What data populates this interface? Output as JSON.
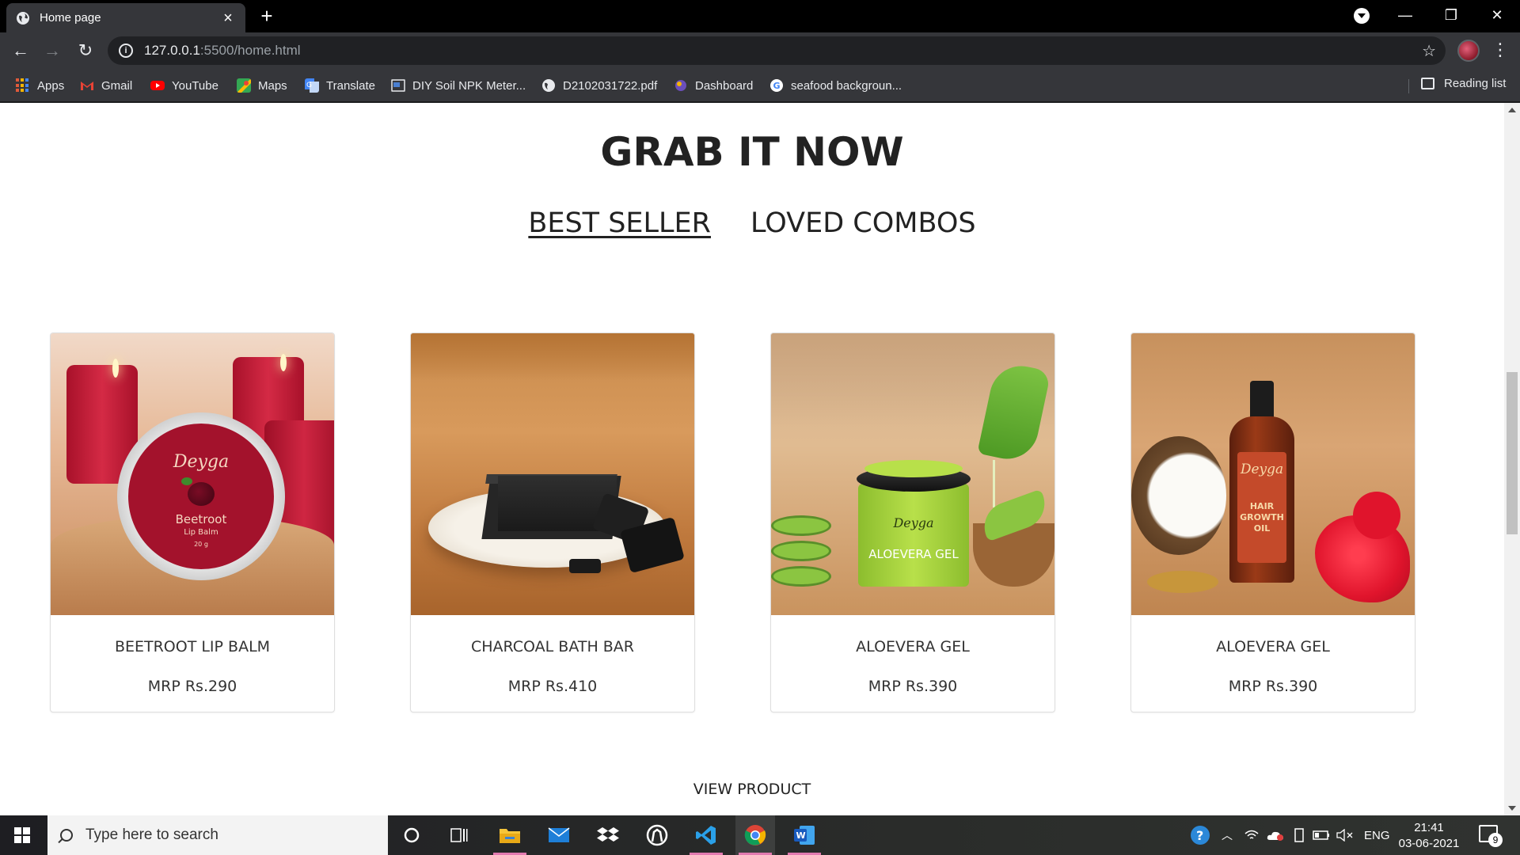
{
  "browser": {
    "tab_title": "Home page",
    "url_host": "127.0.0.1",
    "url_path": ":5500/home.html",
    "bookmarks": [
      {
        "label": "Apps",
        "icon": "apps-grid-icon"
      },
      {
        "label": "Gmail",
        "icon": "gmail-icon"
      },
      {
        "label": "YouTube",
        "icon": "youtube-icon"
      },
      {
        "label": "Maps",
        "icon": "maps-icon"
      },
      {
        "label": "Translate",
        "icon": "translate-icon"
      },
      {
        "label": "DIY Soil NPK Meter...",
        "icon": "page-icon"
      },
      {
        "label": "D2102031722.pdf",
        "icon": "globe-icon"
      },
      {
        "label": "Dashboard",
        "icon": "dashboard-icon"
      },
      {
        "label": "seafood backgroun...",
        "icon": "google-icon"
      }
    ],
    "reading_list": "Reading list"
  },
  "page": {
    "heading": "GRAB IT NOW",
    "tabs": [
      {
        "label": "BEST SELLER",
        "active": true
      },
      {
        "label": "LOVED COMBOS",
        "active": false
      }
    ],
    "products": [
      {
        "name": "BEETROOT LIP BALM",
        "price": "MRP Rs.290",
        "image": "beetroot-lip-balm-image",
        "label_lines": [
          "Deyga",
          "Beetroot",
          "Lip Balm",
          "20 g"
        ]
      },
      {
        "name": "CHARCOAL BATH BAR",
        "price": "MRP Rs.410",
        "image": "charcoal-bath-bar-image"
      },
      {
        "name": "ALOEVERA GEL",
        "price": "MRP Rs.390",
        "image": "aloevera-gel-image",
        "label_lines": [
          "Deyga",
          "ALOEVERA GEL"
        ]
      },
      {
        "name": "ALOEVERA GEL",
        "price": "MRP Rs.390",
        "image": "hair-growth-oil-image",
        "label_lines": [
          "Deyga",
          "HAIR",
          "GROWTH",
          "OIL"
        ]
      }
    ],
    "view_product": "VIEW PRODUCT"
  },
  "taskbar": {
    "search_placeholder": "Type here to search",
    "language": "ENG",
    "time": "21:41",
    "date": "03-06-2021",
    "notifications": "9"
  },
  "colors": {
    "chrome_dark": "#35363a",
    "tab_bar": "#000000",
    "page_bg": "#ffffff",
    "text": "#222222"
  }
}
